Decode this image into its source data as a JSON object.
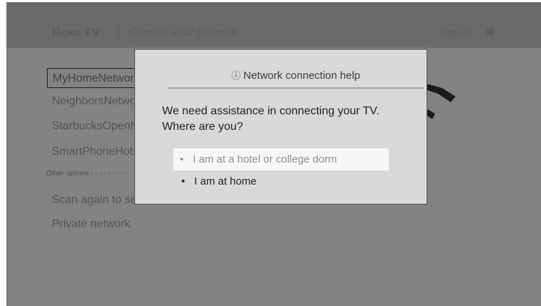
{
  "header": {
    "brand": "Roku TV",
    "separator": "|",
    "title": "Choose your network",
    "options_label": "Options",
    "options_icon": "✱"
  },
  "networks": [
    {
      "label": "MyHomeNetwork",
      "selected": true
    },
    {
      "label": "NeighborsNetwork",
      "selected": false
    },
    {
      "label": "StarbucksOpenNetwork",
      "selected": false
    },
    {
      "label": "SmartPhoneHotspot",
      "selected": false
    }
  ],
  "other_options_label": "Other options - - - - - - - - -",
  "other_options": [
    {
      "label": "Scan again to see all networks"
    },
    {
      "label": "Private network"
    }
  ],
  "modal": {
    "info_icon": "ⓘ",
    "title": "Network connection help",
    "question_line1": "We need assistance in connecting your TV.",
    "question_line2": "Where are you?",
    "choices": [
      {
        "label": "I am at a hotel or college dorm",
        "focused": true
      },
      {
        "label": "I am at home",
        "focused": false
      }
    ],
    "bullet": "•"
  },
  "colors": {
    "screen_bg": "#838383",
    "topbar_bg": "#6a6a6a",
    "modal_bg": "#d9d9d9",
    "focus_bg": "#f7f7f7"
  }
}
